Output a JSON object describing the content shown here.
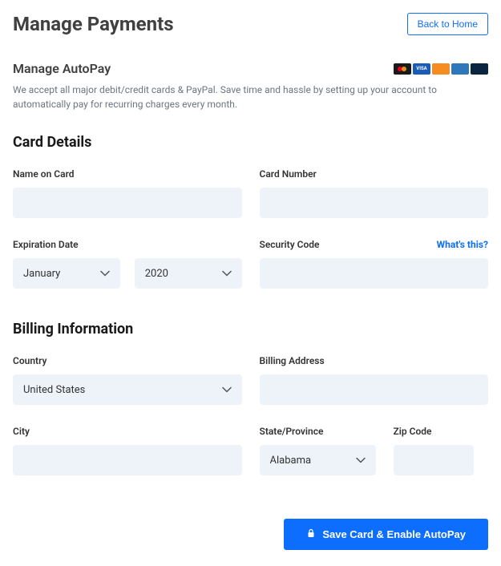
{
  "header": {
    "title": "Manage Payments",
    "back_label": "Back to Home"
  },
  "autopay": {
    "title": "Manage AutoPay",
    "description": "We accept all major debit/credit cards & PayPal. Save time and hassle by setting up your account to automatically pay for recurring charges every month."
  },
  "card_details": {
    "section_title": "Card Details",
    "name_label": "Name on Card",
    "name_value": "",
    "number_label": "Card Number",
    "number_value": "",
    "exp_label": "Expiration Date",
    "exp_month": "January",
    "exp_year": "2020",
    "security_label": "Security Code",
    "security_value": "",
    "help_text": "What's this?"
  },
  "billing": {
    "section_title": "Billing Information",
    "country_label": "Country",
    "country_value": "United States",
    "address_label": "Billing Address",
    "address_value": "",
    "city_label": "City",
    "city_value": "",
    "state_label": "State/Province",
    "state_value": "Alabama",
    "zip_label": "Zip Code",
    "zip_value": ""
  },
  "submit": {
    "label": "Save Card & Enable AutoPay"
  },
  "card_brands": {
    "visa": "VISA"
  }
}
